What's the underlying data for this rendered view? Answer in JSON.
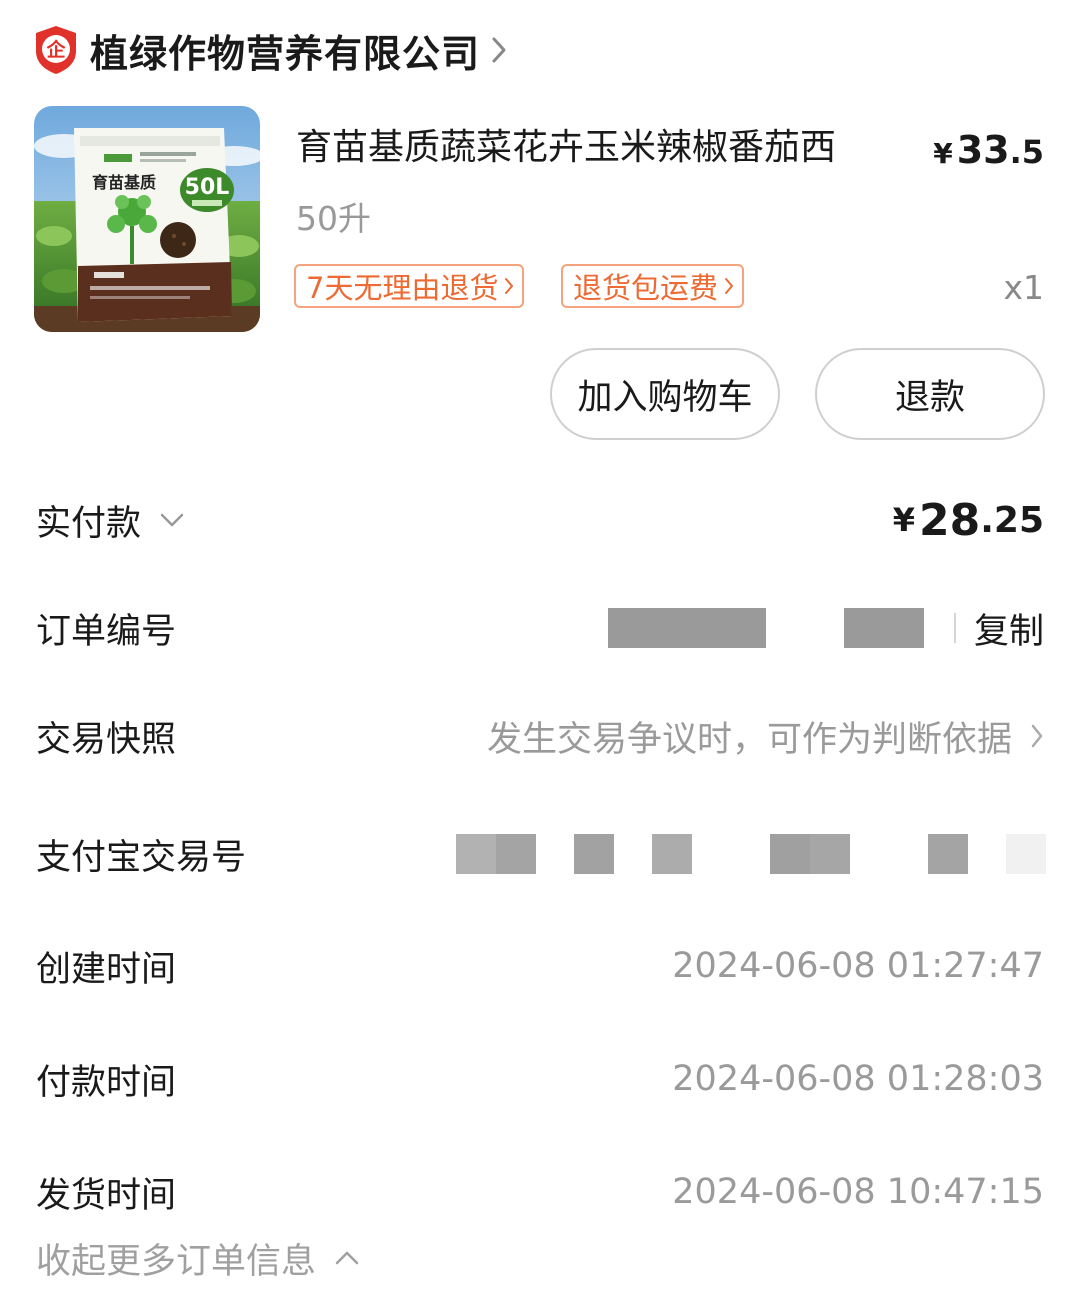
{
  "shop": {
    "badge_char": "企",
    "name": "植绿作物营养有限公司"
  },
  "product": {
    "title": "育苗基质蔬菜花卉玉米辣椒番茄西",
    "price_yen": "¥",
    "price_int": "33",
    "price_dec": ".5",
    "spec": "50升",
    "quantity": "x1",
    "image_text": {
      "bag_label": "育苗基质",
      "volume": "50L"
    },
    "tags": [
      {
        "label": "7天无理由退货"
      },
      {
        "label": "退货包运费"
      }
    ],
    "buttons": {
      "add_to_cart": "加入购物车",
      "refund": "退款"
    }
  },
  "order": {
    "paid": {
      "label": "实付款",
      "yen": "¥",
      "int": "28",
      "dec": ".25"
    },
    "order_number": {
      "label": "订单编号",
      "copy": "复制"
    },
    "snapshot": {
      "label": "交易快照",
      "value": "发生交易争议时，可作为判断依据"
    },
    "alipay_number": {
      "label": "支付宝交易号"
    },
    "created": {
      "label": "创建时间",
      "value": "2024-06-08 01:27:47"
    },
    "paid_time": {
      "label": "付款时间",
      "value": "2024-06-08 01:28:03"
    },
    "shipped": {
      "label": "发货时间",
      "value": "2024-06-08 10:47:15"
    },
    "collapse": "收起更多订单信息"
  },
  "colors": {
    "badge_red": "#e0322a",
    "tag_orange": "#ee6a33",
    "tag_border": "#f4a37c",
    "muted_text": "#9a9a9a"
  },
  "icons": {
    "shop_badge": "enterprise-shield-icon",
    "shop_chevron": "chevron-right-icon",
    "paid_toggle": "chevron-down-icon",
    "snapshot_chevron": "chevron-right-icon",
    "collapse_toggle": "chevron-up-icon"
  }
}
